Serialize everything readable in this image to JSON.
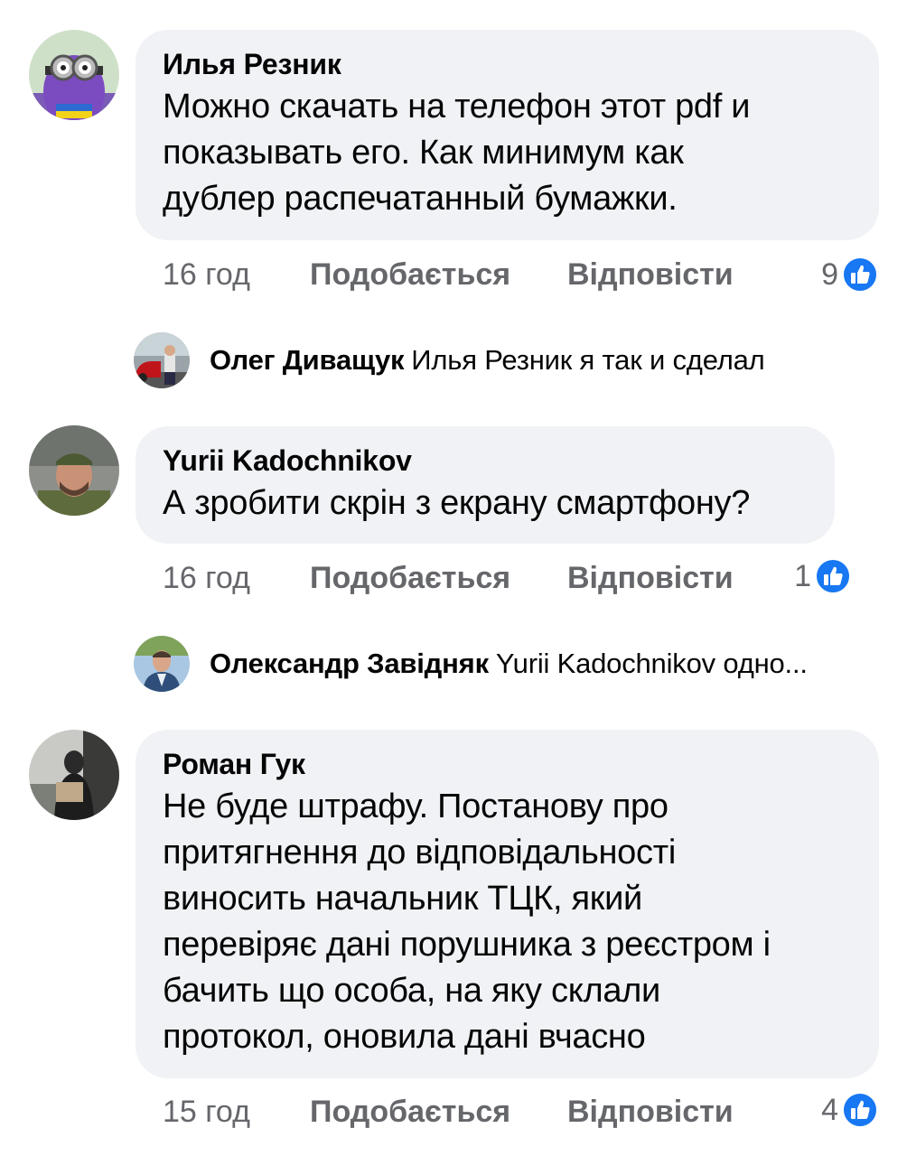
{
  "comments": [
    {
      "author": "Илья Резник",
      "text": "Можно скачать на телефон этот pdf и\nпоказывать его. Как минимум как\nдублер распечатанный бумажки.",
      "time": "16 год",
      "like_label": "Подобається",
      "reply_label": "Відповісти",
      "reaction_count": "9",
      "reaction_icon": "like-icon",
      "avatar_icon": "minion-avatar",
      "reply": {
        "author": "Олег Диващук",
        "text": "Илья Резник я так и сделал",
        "avatar_icon": "man-with-car-avatar"
      }
    },
    {
      "author": "Yurii Kadochnikov",
      "text": "А зробити скрін з екрану смартфону?",
      "time": "16 год",
      "like_label": "Подобається",
      "reply_label": "Відповісти",
      "reaction_count": "1",
      "reaction_icon": "like-icon",
      "avatar_icon": "man-with-cap-avatar",
      "reply": {
        "author": "Олександр Завідняк",
        "text": "Yurii Kadochnikov одно...",
        "avatar_icon": "man-in-suit-avatar"
      }
    },
    {
      "author": "Роман Гук",
      "text": "Не буде штрафу. Постанову про\nпритягнення до відповідальності\nвиносить начальник ТЦК, який\nперевіряє дані порушника з реєстром і\nбачить що особа, на яку склали\nпротокол, оновила дані вчасно",
      "time": "15 год",
      "like_label": "Подобається",
      "reply_label": "Відповісти",
      "reaction_count": "4",
      "reaction_icon": "like-icon",
      "avatar_icon": "person-dark-avatar"
    }
  ],
  "colors": {
    "bubble": "#f0f2f5",
    "text": "#050505",
    "secondary": "#65676b",
    "like_blue": "#1877f2"
  }
}
